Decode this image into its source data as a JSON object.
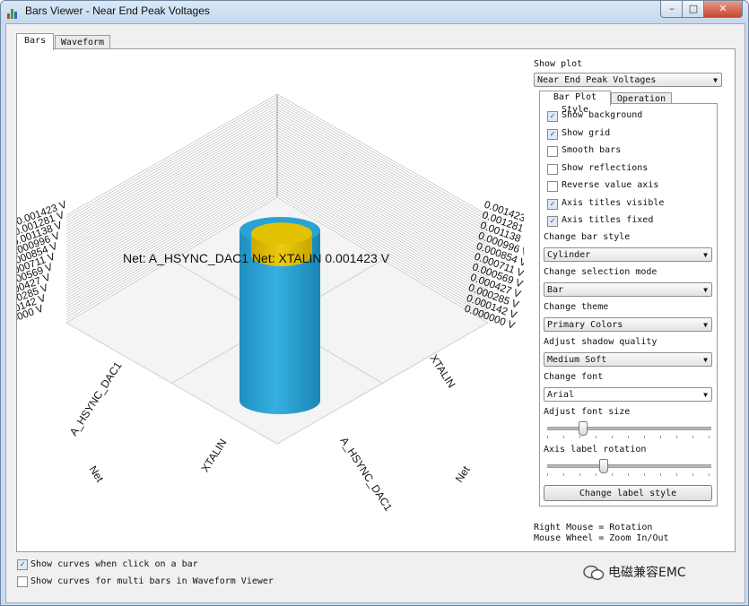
{
  "window": {
    "title": "Bars Viewer - Near End Peak Voltages",
    "controls": {
      "minimize": "–",
      "maximize": "□",
      "close": "✕"
    }
  },
  "tabs": [
    {
      "label": "Bars",
      "active": true
    },
    {
      "label": "Waveform",
      "active": false
    }
  ],
  "plot": {
    "selection_label": "Net: A_HSYNC_DAC1 Net: XTALIN 0.001423 V",
    "left_axis_ticks": [
      "0.001423 V",
      "0.001281 V",
      "0.001138 V",
      "0.000996 V",
      "0.000854 V",
      "0.000711 V",
      "0.000569 V",
      "0.000427 V",
      "0.000285 V",
      "0.000142 V",
      "0.000000 V"
    ],
    "right_axis_ticks": [
      "0.001423 V",
      "0.001281 V",
      "0.001138 V",
      "0.000996 V",
      "0.000854 V",
      "0.000711 V",
      "0.000569 V",
      "0.000427 V",
      "0.000285 V",
      "0.000142 V",
      "0.000000 V"
    ],
    "row_labels": [
      "A_HSYNC_DAC1",
      "XTALIN"
    ],
    "column_labels": [
      "XTALIN",
      "A_HSYNC_DAC1"
    ],
    "row_axis_title": "Net",
    "column_axis_title": "Net",
    "bars": [
      {
        "row": "A_HSYNC_DAC1",
        "column": "XTALIN",
        "value": 0.001423,
        "color": "#2aa3d4",
        "selected": true
      },
      {
        "row": "XTALIN",
        "column": "XTALIN",
        "value": 0.001423,
        "color": "#e2c200",
        "selected": false
      }
    ]
  },
  "side": {
    "show_plot_label": "Show plot",
    "show_plot_value": "Near End Peak Voltages",
    "subtabs": [
      {
        "label": "Bar Plot Style",
        "active": true
      },
      {
        "label": "Operation",
        "active": false
      }
    ],
    "checkboxes": [
      {
        "label": "Show background",
        "checked": true
      },
      {
        "label": "Show grid",
        "checked": true
      },
      {
        "label": "Smooth bars",
        "checked": false
      },
      {
        "label": "Show reflections",
        "checked": false
      },
      {
        "label": "Reverse value axis",
        "checked": false
      },
      {
        "label": "Axis titles visible",
        "checked": true
      },
      {
        "label": "Axis titles fixed",
        "checked": true
      }
    ],
    "bar_style_label": "Change bar style",
    "bar_style_value": "Cylinder",
    "selection_mode_label": "Change selection mode",
    "selection_mode_value": "Bar",
    "theme_label": "Change theme",
    "theme_value": "Primary Colors",
    "shadow_label": "Adjust shadow quality",
    "shadow_value": "Medium Soft",
    "font_label": "Change font",
    "font_value": "Arial",
    "font_size_label": "Adjust font size",
    "font_size_fraction": 0.2,
    "rotation_label": "Axis label rotation",
    "rotation_fraction": 0.33,
    "label_style_button": "Change label style",
    "hint_rotation": "Right Mouse = Rotation",
    "hint_zoom": "Mouse Wheel = Zoom In/Out"
  },
  "bottom": {
    "options": [
      {
        "label": "Show curves when click on a bar",
        "checked": true
      },
      {
        "label": "Show curves for multi bars in Waveform Viewer",
        "checked": false
      }
    ]
  },
  "watermark": "电磁兼容EMC",
  "colors": {
    "bar_selected": "#2aa3d4",
    "bar_other": "#e2c200",
    "titlebar": "#c4d8ee"
  }
}
